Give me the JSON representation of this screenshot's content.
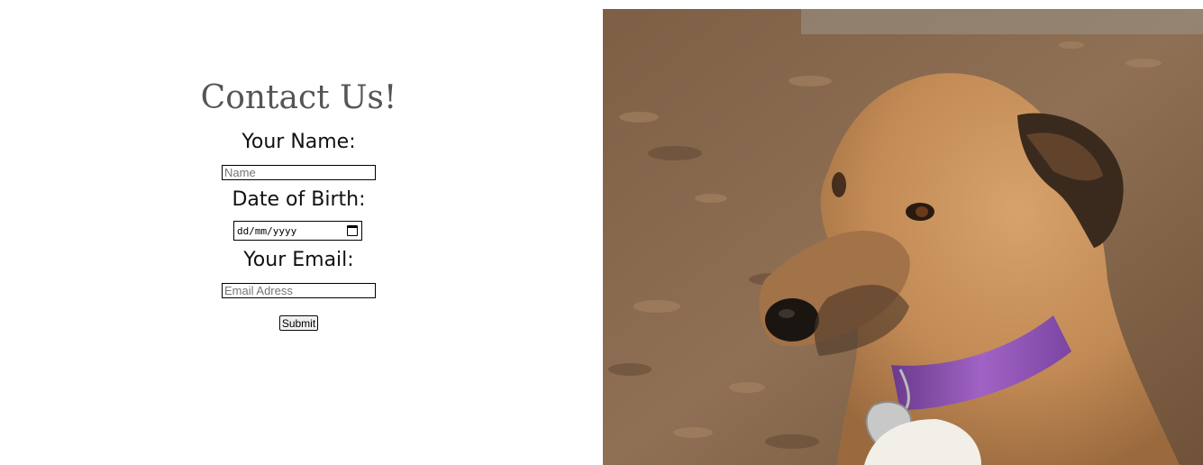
{
  "contact_form": {
    "title": "Contact Us!",
    "name_label": "Your Name:",
    "name_placeholder": "Name",
    "name_value": "",
    "dob_label": "Date of Birth:",
    "dob_placeholder": "dd/mm/yyyy",
    "email_label": "Your Email:",
    "email_placeholder": "Email Adress",
    "email_value": "",
    "submit_label": "Submit",
    "calendar_icon": "calendar-icon"
  },
  "photo": {
    "subject": "dog-photo",
    "colors": {
      "ground": "#8a6a4c",
      "fur": "#c8905a",
      "collar": "#8a4fb0"
    }
  },
  "colors": {
    "title": "#555555",
    "label": "#111111",
    "background": "#ffffff"
  }
}
